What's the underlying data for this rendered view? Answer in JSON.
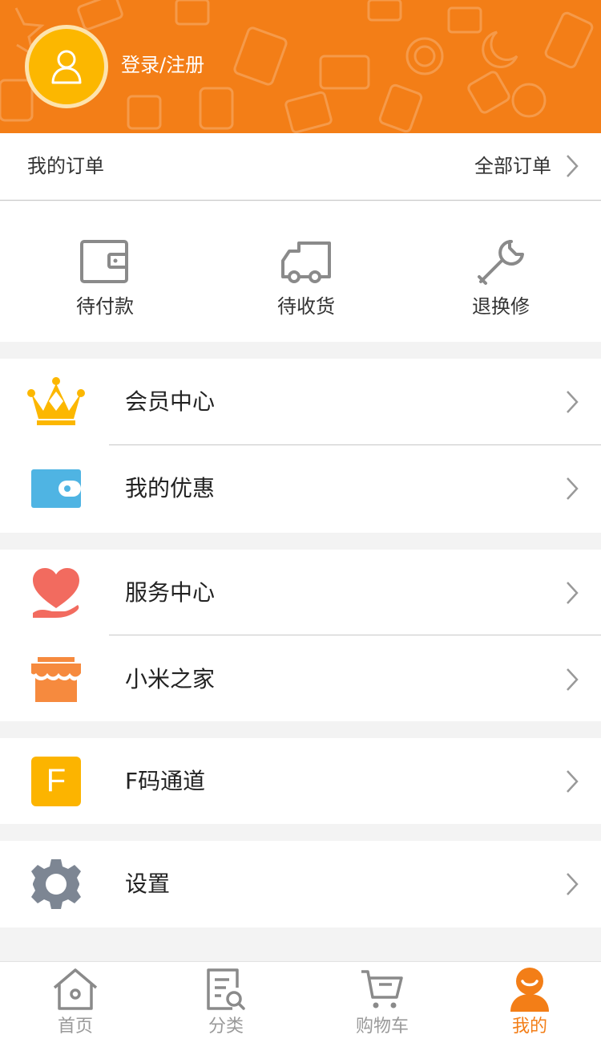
{
  "header": {
    "login_label": "登录/注册",
    "avatar_icon": "user-icon",
    "bg_color": "#f37e17"
  },
  "orders": {
    "title": "我的订单",
    "all_label": "全部订单",
    "statuses": [
      {
        "label": "待付款",
        "icon": "wallet-icon"
      },
      {
        "label": "待收货",
        "icon": "truck-icon"
      },
      {
        "label": "退换修",
        "icon": "wrench-icon"
      }
    ]
  },
  "menu": {
    "member_center": "会员中心",
    "coupons": "我的优惠",
    "service_center": "服务中心",
    "mi_home": "小米之家",
    "fcode": "F码通道",
    "fcode_letter": "F",
    "settings": "设置"
  },
  "nav": {
    "items": [
      {
        "label": "首页",
        "icon": "home-icon"
      },
      {
        "label": "分类",
        "icon": "category-search-icon"
      },
      {
        "label": "购物车",
        "icon": "cart-icon"
      },
      {
        "label": "我的",
        "icon": "profile-icon"
      }
    ],
    "active_color": "#f37e17"
  }
}
